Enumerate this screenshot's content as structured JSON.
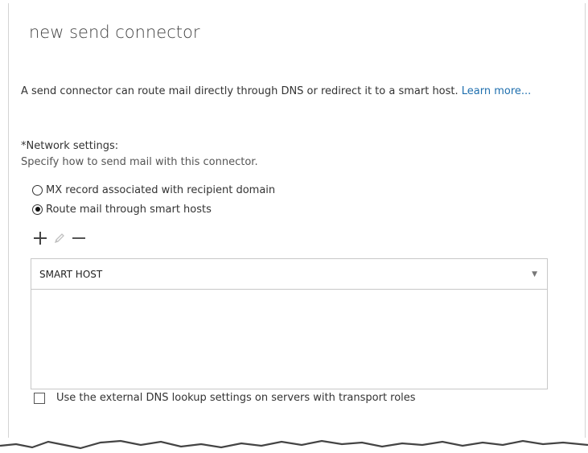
{
  "dialog": {
    "title": "new send connector",
    "intro_text": "A send connector can route mail directly through DNS or redirect it to a smart host. ",
    "learn_more": "Learn more..."
  },
  "network": {
    "title": "*Network settings:",
    "description": "Specify how to send mail with this connector.",
    "options": [
      {
        "label": "MX record associated with recipient domain",
        "selected": false
      },
      {
        "label": "Route mail through smart hosts",
        "selected": true
      }
    ]
  },
  "toolbar": {
    "add_icon": "plus-icon",
    "edit_icon": "pencil-icon",
    "remove_icon": "minus-icon"
  },
  "smart_host_table": {
    "column_header": "SMART HOST",
    "rows": []
  },
  "external_dns": {
    "label": "Use the external DNS lookup settings on servers with transport roles",
    "checked": false
  },
  "colors": {
    "link": "#1f6fae",
    "border": "#c8c8c8",
    "text": "#333333"
  }
}
